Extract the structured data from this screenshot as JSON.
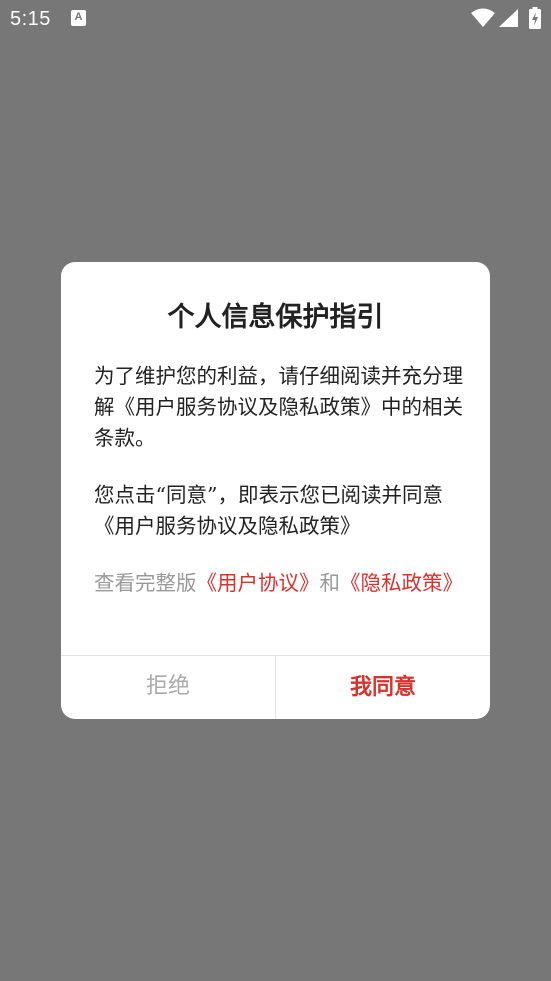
{
  "status_bar": {
    "time": "5:15",
    "notification_icon": "A",
    "icons": [
      "wifi-icon",
      "signal-icon",
      "battery-charging-icon"
    ]
  },
  "dialog": {
    "title": "个人信息保护指引",
    "paragraph1": "为了维护您的利益，请仔细阅读并充分理解《用户服务协议及隐私政策》中的相关条款。",
    "paragraph2": "您点击“同意”，即表示您已阅读并同意 《用户服务协议及隐私政策》",
    "view_prefix": "查看完整版",
    "user_agreement_link": "《用户协议》",
    "and_text": "和",
    "privacy_link": "《隐私政策》",
    "refuse_button": "拒绝",
    "agree_button": "我同意"
  },
  "colors": {
    "overlay": "#777777",
    "dialog_bg": "#ffffff",
    "accent": "#d8322e",
    "muted": "#999999"
  }
}
